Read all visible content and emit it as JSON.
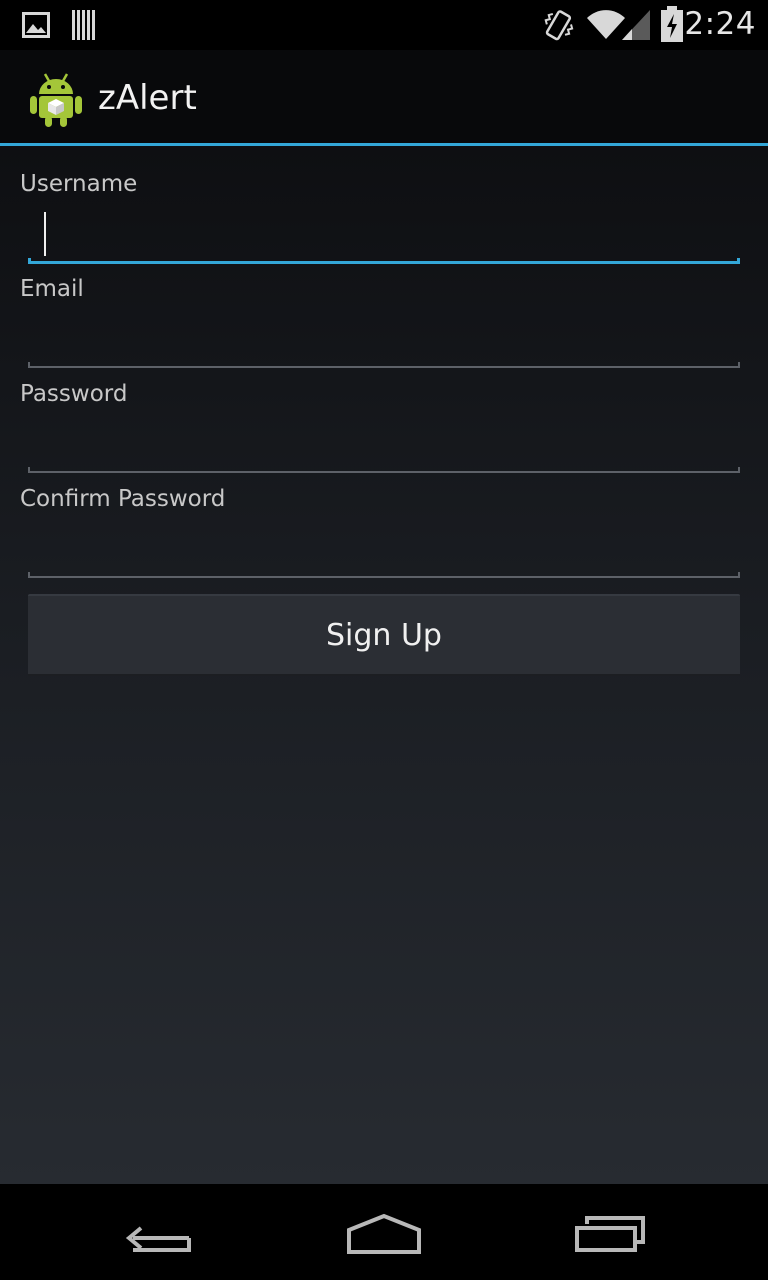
{
  "status_bar": {
    "time": "2:24",
    "left_icons": [
      "image-notification-icon",
      "barcode-notification-icon"
    ],
    "right_icons": [
      "vibrate-icon",
      "wifi-icon",
      "signal-icon",
      "battery-charging-icon"
    ]
  },
  "action_bar": {
    "app_icon": "android-app-icon",
    "title": "zAlert"
  },
  "form": {
    "username": {
      "label": "Username",
      "value": ""
    },
    "email": {
      "label": "Email",
      "value": ""
    },
    "password": {
      "label": "Password",
      "value": ""
    },
    "confirm_password": {
      "label": "Confirm Password",
      "value": ""
    },
    "signup_label": "Sign Up"
  },
  "colors": {
    "accent": "#33a7d8",
    "android_green": "#a4c639"
  },
  "nav_bar": {
    "buttons": [
      "back-icon",
      "home-icon",
      "recents-icon"
    ]
  }
}
